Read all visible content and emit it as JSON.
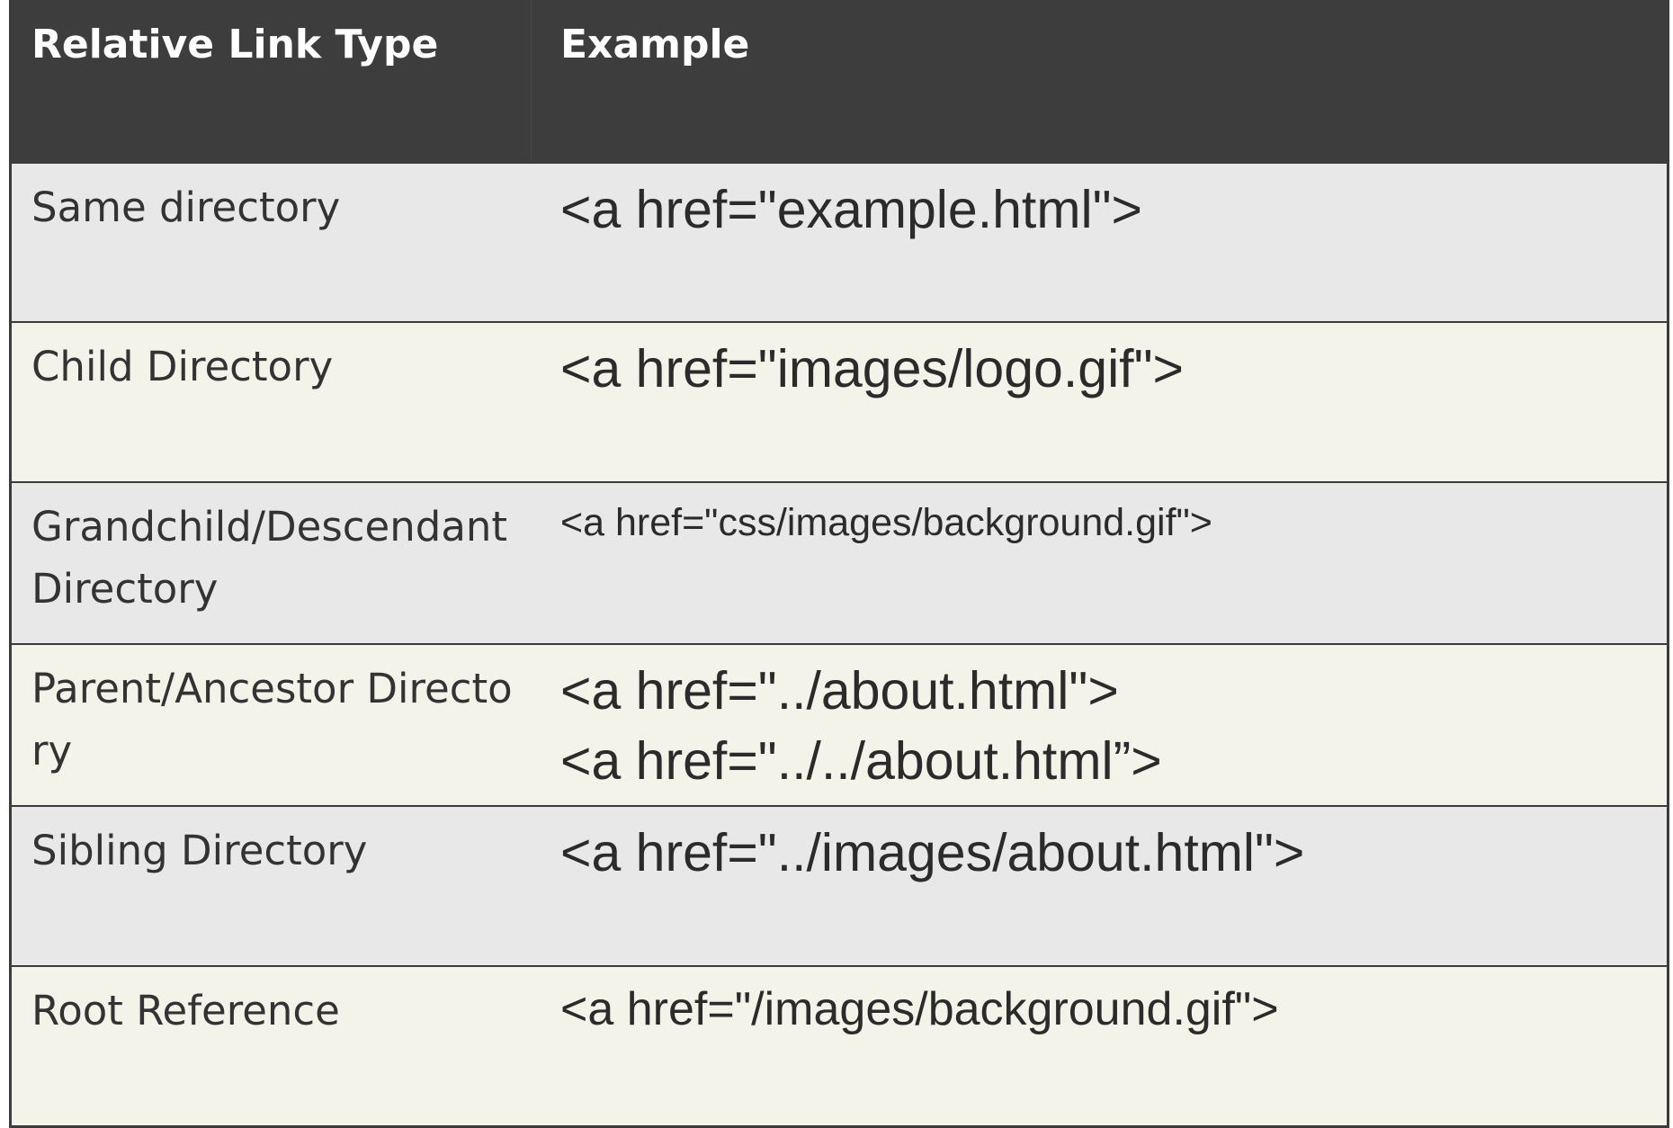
{
  "table": {
    "headers": [
      "Relative Link Type",
      "Example"
    ],
    "rows": [
      {
        "type": "Same directory",
        "examples": [
          "<a href=\"example.html\">"
        ]
      },
      {
        "type": "Child Directory",
        "examples": [
          "<a href=\"images/logo.gif\">"
        ]
      },
      {
        "type": "Grandchild/Descendant Directory",
        "examples": [
          "<a href=\"css/images/background.gif\">"
        ]
      },
      {
        "type": "Parent/Ancestor Directory",
        "examples": [
          "<a href=\"../about.html\">",
          "<a href=\"../../about.html”>"
        ]
      },
      {
        "type": "Sibling Directory",
        "examples": [
          "<a href=\"../images/about.html\">"
        ]
      },
      {
        "type": "Root Reference",
        "examples": [
          "<a href=\"/images/background.gif\">"
        ]
      }
    ]
  },
  "colors": {
    "header_bg": "#3d3d3d",
    "row_shade_a": "#e8e8e8",
    "row_shade_b": "#f3f3e9",
    "border": "#3b3b3b"
  }
}
